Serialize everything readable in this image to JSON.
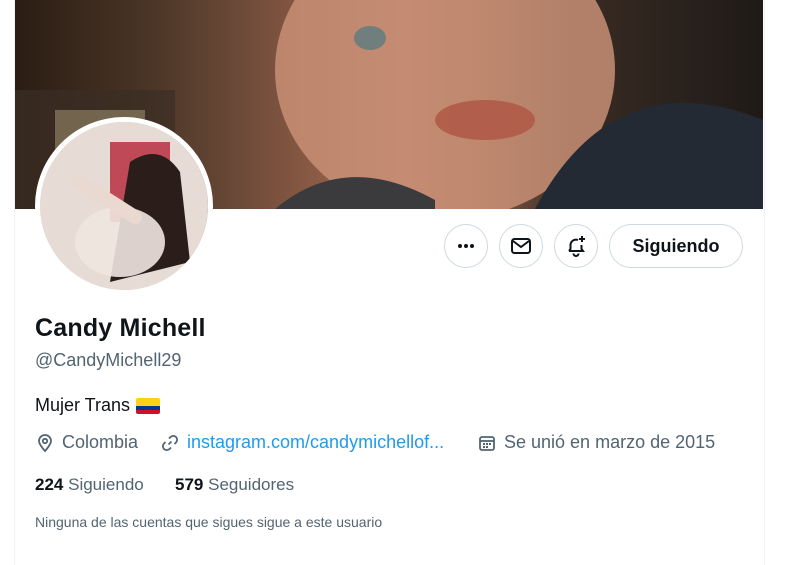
{
  "profile": {
    "name": "Candy Michell",
    "handle": "@CandyMichell29",
    "bio": "Mujer Trans",
    "bio_flag": "Colombia flag emoji",
    "location": "Colombia",
    "website": "instagram.com/candymichellof...",
    "joined": "Se unió en marzo de 2015",
    "following_count": "224",
    "following_label": "Siguiendo",
    "followers_count": "579",
    "followers_label": "Seguidores",
    "followers_you_know": "Ninguna de las cuentas que sigues sigue a este usuario"
  },
  "actions": {
    "more_icon": "more-icon",
    "message_icon": "mail-icon",
    "notify_icon": "bell-plus-icon",
    "follow_label": "Siguiendo"
  },
  "colors": {
    "accent": "#1d9bf0",
    "text": "#0f1419",
    "secondary": "#536471",
    "border": "#cfd9de"
  }
}
